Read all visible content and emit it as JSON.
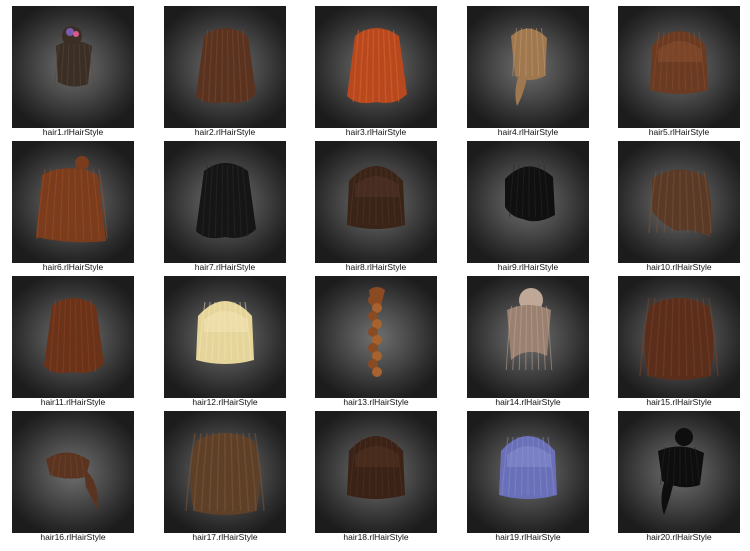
{
  "items": [
    {
      "label": "hair1.rlHairStyle",
      "style": "bun-flower",
      "color": "#3a2e25",
      "accent": "#5a4a3c"
    },
    {
      "label": "hair2.rlHairStyle",
      "style": "long-straight",
      "color": "#5a3320",
      "accent": "#7a4a30"
    },
    {
      "label": "hair3.rlHairStyle",
      "style": "long-straight",
      "color": "#b8491f",
      "accent": "#e0652c"
    },
    {
      "label": "hair4.rlHairStyle",
      "style": "side-tail",
      "color": "#a07850",
      "accent": "#c49a6a"
    },
    {
      "label": "hair5.rlHairStyle",
      "style": "bob",
      "color": "#6a3a22",
      "accent": "#8a5030"
    },
    {
      "label": "hair6.rlHairStyle",
      "style": "topknot-long",
      "color": "#7a3c1c",
      "accent": "#9a5028"
    },
    {
      "label": "hair7.rlHairStyle",
      "style": "long-straight",
      "color": "#151515",
      "accent": "#2a2a2a"
    },
    {
      "label": "hair8.rlHairStyle",
      "style": "bob",
      "color": "#3a2418",
      "accent": "#54362a"
    },
    {
      "label": "hair9.rlHairStyle",
      "style": "short-bob",
      "color": "#101010",
      "accent": "#262626"
    },
    {
      "label": "hair10.rlHairStyle",
      "style": "messy-wavy",
      "color": "#5a3a26",
      "accent": "#7a5236"
    },
    {
      "label": "hair11.rlHairStyle",
      "style": "long-straight",
      "color": "#6a3218",
      "accent": "#8a4424"
    },
    {
      "label": "hair12.rlHairStyle",
      "style": "bob",
      "color": "#e6d59a",
      "accent": "#f4e7b8"
    },
    {
      "label": "hair13.rlHairStyle",
      "style": "braid",
      "color": "#8a4a22",
      "accent": "#a8622e"
    },
    {
      "label": "hair14.rlHairStyle",
      "style": "messy-bun",
      "color": "#9a8070",
      "accent": "#c0a898"
    },
    {
      "label": "hair15.rlHairStyle",
      "style": "long-wavy",
      "color": "#5a2e1a",
      "accent": "#7a4228"
    },
    {
      "label": "hair16.rlHairStyle",
      "style": "ponytail",
      "color": "#5a3420",
      "accent": "#7a4a2e"
    },
    {
      "label": "hair17.rlHairStyle",
      "style": "long-wavy",
      "color": "#5e4028",
      "accent": "#7e5838"
    },
    {
      "label": "hair18.rlHairStyle",
      "style": "bob",
      "color": "#3a2216",
      "accent": "#543424"
    },
    {
      "label": "hair19.rlHairStyle",
      "style": "bob",
      "color": "#6a70b8",
      "accent": "#8a90d0"
    },
    {
      "label": "hair20.rlHairStyle",
      "style": "bun-tail",
      "color": "#0e0e0e",
      "accent": "#242424"
    }
  ]
}
